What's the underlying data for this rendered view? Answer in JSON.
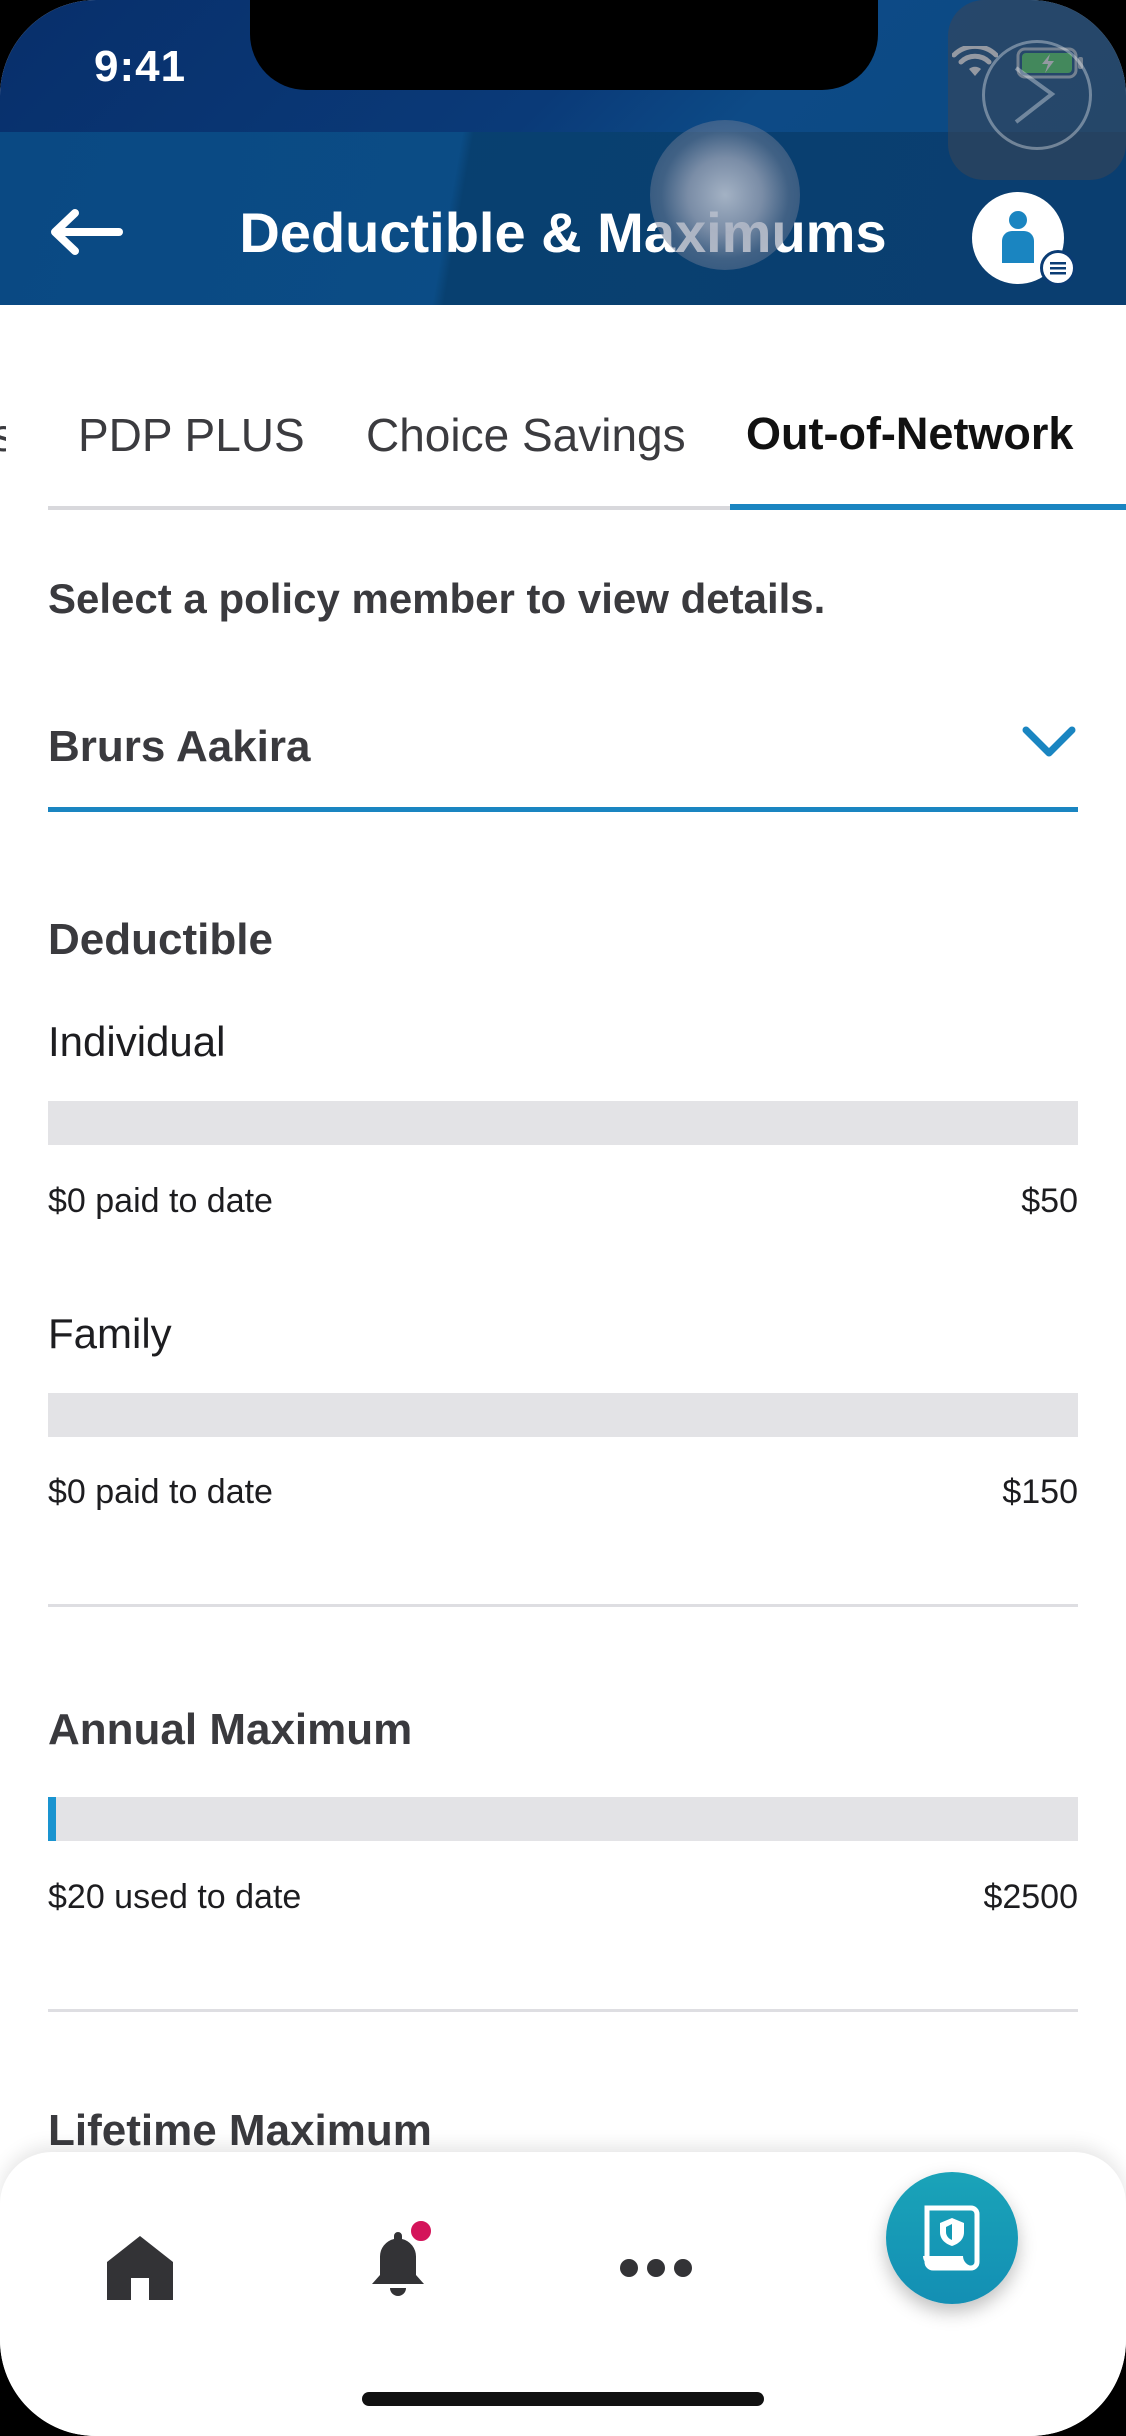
{
  "status_bar": {
    "time": "9:41"
  },
  "header": {
    "title": "Deductible & Maximums"
  },
  "tabs": [
    {
      "label": "PDP PLUS",
      "active": false
    },
    {
      "label": "Choice Savings",
      "active": false
    },
    {
      "label": "Out-of-Network",
      "active": true
    }
  ],
  "member_selector": {
    "prompt": "Select a policy member to view details.",
    "selected": "Brurs Aakira"
  },
  "deductible": {
    "title": "Deductible",
    "individual": {
      "label": "Individual",
      "paid_text": "$0 paid to date",
      "limit_text": "$50",
      "paid": 0,
      "limit": 50
    },
    "family": {
      "label": "Family",
      "paid_text": "$0 paid to date",
      "limit_text": "$150",
      "paid": 0,
      "limit": 150
    }
  },
  "annual_maximum": {
    "title": "Annual Maximum",
    "used_text": "$20 used to date",
    "limit_text": "$2500",
    "used": 20,
    "limit": 2500
  },
  "lifetime_maximum": {
    "title": "Lifetime Maximum"
  },
  "bottom_nav": {
    "items": [
      {
        "icon": "home-icon"
      },
      {
        "icon": "bell-icon",
        "has_notification": true
      },
      {
        "icon": "more-icon"
      },
      {
        "icon": "id-card-icon"
      }
    ]
  },
  "colors": {
    "header_dark": "#082f6b",
    "accent": "#1a85c1",
    "bar_fill": "#1a94d0",
    "bar_track": "#e3e3e6",
    "fab": "#1aa3b8",
    "notification_dot": "#d4145a"
  }
}
